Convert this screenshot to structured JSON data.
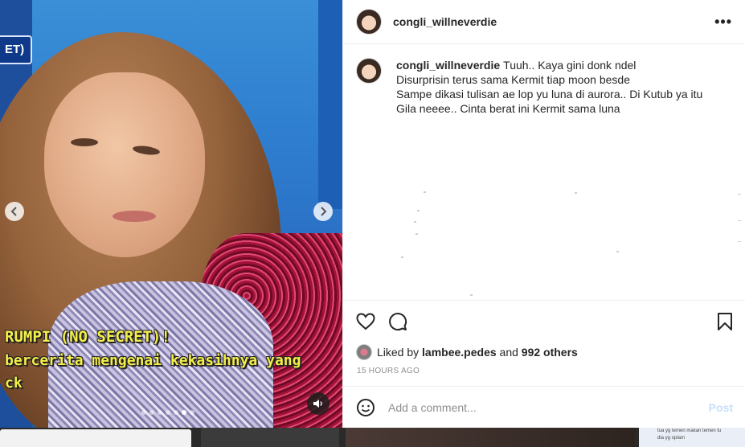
{
  "media": {
    "corner_tag": "ET)",
    "caption_lines": [
      "RUMPI (NO SECRET)!",
      "bercerita mengenai kekasihnya yang",
      "ck"
    ],
    "carousel_dots": 7,
    "active_dot": 5
  },
  "post": {
    "author": "congli_willneverdie",
    "caption_username": "congli_willneverdie",
    "caption_lines": [
      "Tuuh.. Kaya gini donk ndel",
      "Disurprisin terus sama Kermit tiap moon besde",
      "Sampe dikasi tulisan ae lop yu luna di aurora.. Di Kutub ya itu",
      "Gila neeee.. Cinta berat ini Kermit sama luna"
    ],
    "likes_prefix": "Liked by",
    "liked_by_user": "lambee.pedes",
    "likes_suffix_and": "and",
    "likes_others": "992 others",
    "timestamp": "15 HOURS AGO",
    "comment_placeholder": "Add a comment...",
    "post_button": "Post"
  },
  "background_strip": {
    "tiny_text_1": "tua yg temen makan temen tu",
    "tiny_text_2": "dia yg oplam"
  },
  "colors": {
    "caption_yellow": "#f4ee4a",
    "post_disabled": "#c7dffa",
    "text_primary": "#262626",
    "text_secondary": "#8e8e8e"
  }
}
